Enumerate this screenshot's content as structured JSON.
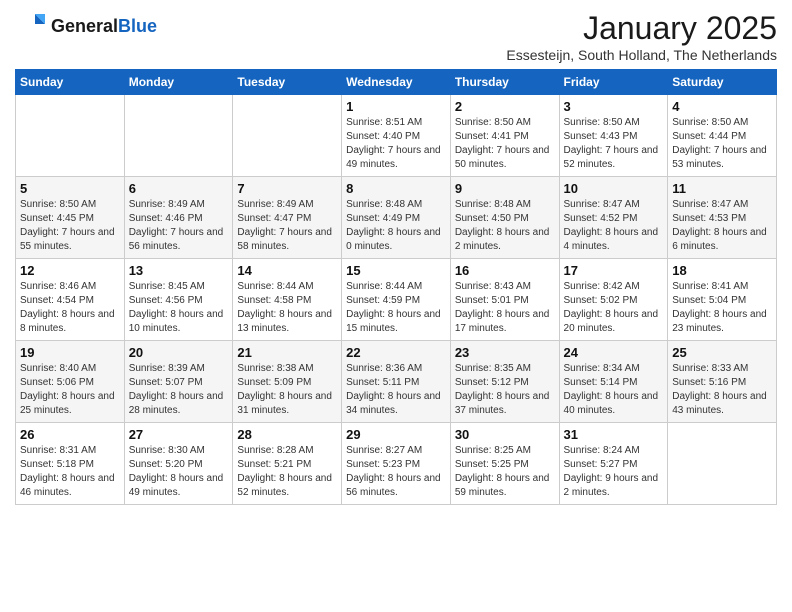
{
  "header": {
    "logo_general": "General",
    "logo_blue": "Blue",
    "month_year": "January 2025",
    "location": "Essesteijn, South Holland, The Netherlands"
  },
  "days_of_week": [
    "Sunday",
    "Monday",
    "Tuesday",
    "Wednesday",
    "Thursday",
    "Friday",
    "Saturday"
  ],
  "weeks": [
    [
      {
        "day": "",
        "info": ""
      },
      {
        "day": "",
        "info": ""
      },
      {
        "day": "",
        "info": ""
      },
      {
        "day": "1",
        "info": "Sunrise: 8:51 AM\nSunset: 4:40 PM\nDaylight: 7 hours and 49 minutes."
      },
      {
        "day": "2",
        "info": "Sunrise: 8:50 AM\nSunset: 4:41 PM\nDaylight: 7 hours and 50 minutes."
      },
      {
        "day": "3",
        "info": "Sunrise: 8:50 AM\nSunset: 4:43 PM\nDaylight: 7 hours and 52 minutes."
      },
      {
        "day": "4",
        "info": "Sunrise: 8:50 AM\nSunset: 4:44 PM\nDaylight: 7 hours and 53 minutes."
      }
    ],
    [
      {
        "day": "5",
        "info": "Sunrise: 8:50 AM\nSunset: 4:45 PM\nDaylight: 7 hours and 55 minutes."
      },
      {
        "day": "6",
        "info": "Sunrise: 8:49 AM\nSunset: 4:46 PM\nDaylight: 7 hours and 56 minutes."
      },
      {
        "day": "7",
        "info": "Sunrise: 8:49 AM\nSunset: 4:47 PM\nDaylight: 7 hours and 58 minutes."
      },
      {
        "day": "8",
        "info": "Sunrise: 8:48 AM\nSunset: 4:49 PM\nDaylight: 8 hours and 0 minutes."
      },
      {
        "day": "9",
        "info": "Sunrise: 8:48 AM\nSunset: 4:50 PM\nDaylight: 8 hours and 2 minutes."
      },
      {
        "day": "10",
        "info": "Sunrise: 8:47 AM\nSunset: 4:52 PM\nDaylight: 8 hours and 4 minutes."
      },
      {
        "day": "11",
        "info": "Sunrise: 8:47 AM\nSunset: 4:53 PM\nDaylight: 8 hours and 6 minutes."
      }
    ],
    [
      {
        "day": "12",
        "info": "Sunrise: 8:46 AM\nSunset: 4:54 PM\nDaylight: 8 hours and 8 minutes."
      },
      {
        "day": "13",
        "info": "Sunrise: 8:45 AM\nSunset: 4:56 PM\nDaylight: 8 hours and 10 minutes."
      },
      {
        "day": "14",
        "info": "Sunrise: 8:44 AM\nSunset: 4:58 PM\nDaylight: 8 hours and 13 minutes."
      },
      {
        "day": "15",
        "info": "Sunrise: 8:44 AM\nSunset: 4:59 PM\nDaylight: 8 hours and 15 minutes."
      },
      {
        "day": "16",
        "info": "Sunrise: 8:43 AM\nSunset: 5:01 PM\nDaylight: 8 hours and 17 minutes."
      },
      {
        "day": "17",
        "info": "Sunrise: 8:42 AM\nSunset: 5:02 PM\nDaylight: 8 hours and 20 minutes."
      },
      {
        "day": "18",
        "info": "Sunrise: 8:41 AM\nSunset: 5:04 PM\nDaylight: 8 hours and 23 minutes."
      }
    ],
    [
      {
        "day": "19",
        "info": "Sunrise: 8:40 AM\nSunset: 5:06 PM\nDaylight: 8 hours and 25 minutes."
      },
      {
        "day": "20",
        "info": "Sunrise: 8:39 AM\nSunset: 5:07 PM\nDaylight: 8 hours and 28 minutes."
      },
      {
        "day": "21",
        "info": "Sunrise: 8:38 AM\nSunset: 5:09 PM\nDaylight: 8 hours and 31 minutes."
      },
      {
        "day": "22",
        "info": "Sunrise: 8:36 AM\nSunset: 5:11 PM\nDaylight: 8 hours and 34 minutes."
      },
      {
        "day": "23",
        "info": "Sunrise: 8:35 AM\nSunset: 5:12 PM\nDaylight: 8 hours and 37 minutes."
      },
      {
        "day": "24",
        "info": "Sunrise: 8:34 AM\nSunset: 5:14 PM\nDaylight: 8 hours and 40 minutes."
      },
      {
        "day": "25",
        "info": "Sunrise: 8:33 AM\nSunset: 5:16 PM\nDaylight: 8 hours and 43 minutes."
      }
    ],
    [
      {
        "day": "26",
        "info": "Sunrise: 8:31 AM\nSunset: 5:18 PM\nDaylight: 8 hours and 46 minutes."
      },
      {
        "day": "27",
        "info": "Sunrise: 8:30 AM\nSunset: 5:20 PM\nDaylight: 8 hours and 49 minutes."
      },
      {
        "day": "28",
        "info": "Sunrise: 8:28 AM\nSunset: 5:21 PM\nDaylight: 8 hours and 52 minutes."
      },
      {
        "day": "29",
        "info": "Sunrise: 8:27 AM\nSunset: 5:23 PM\nDaylight: 8 hours and 56 minutes."
      },
      {
        "day": "30",
        "info": "Sunrise: 8:25 AM\nSunset: 5:25 PM\nDaylight: 8 hours and 59 minutes."
      },
      {
        "day": "31",
        "info": "Sunrise: 8:24 AM\nSunset: 5:27 PM\nDaylight: 9 hours and 2 minutes."
      },
      {
        "day": "",
        "info": ""
      }
    ]
  ]
}
